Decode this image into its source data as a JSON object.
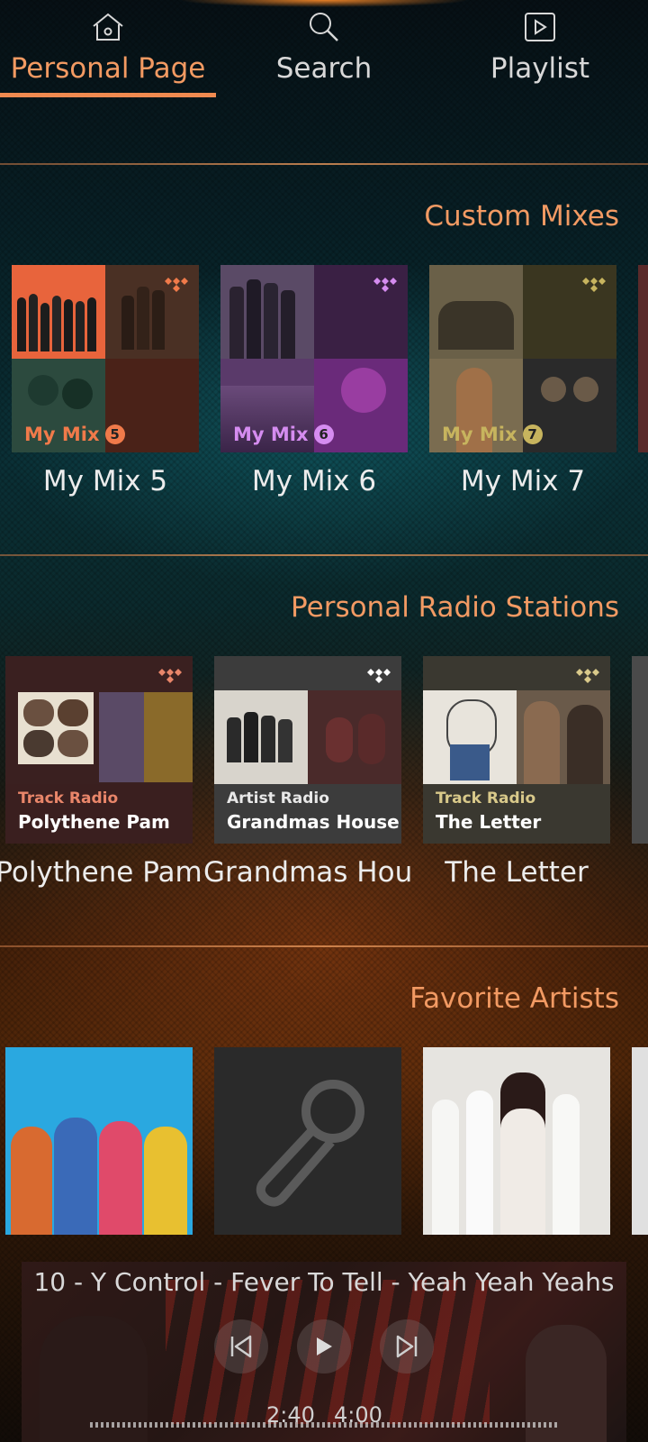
{
  "tabs": [
    {
      "label": "Personal Page",
      "icon": "home-icon",
      "active": true
    },
    {
      "label": "Search",
      "icon": "search-icon",
      "active": false
    },
    {
      "label": "Playlist",
      "icon": "playlist-icon",
      "active": false
    }
  ],
  "custom_mixes": {
    "title": "Custom Mixes",
    "items": [
      {
        "label": "My Mix 5",
        "badge_text": "My Mix",
        "badge_num": "5",
        "accent": "#f07a4a"
      },
      {
        "label": "My Mix 6",
        "badge_text": "My Mix",
        "badge_num": "6",
        "accent": "#d58cf0"
      },
      {
        "label": "My Mix 7",
        "badge_text": "My Mix",
        "badge_num": "7",
        "accent": "#c7b45e"
      }
    ]
  },
  "radio_stations": {
    "title": "Personal Radio Stations",
    "items": [
      {
        "label": "Polythene Pam",
        "type": "Track Radio",
        "name": "Polythene Pam",
        "type_color": "#e9866a"
      },
      {
        "label": "Grandmas House",
        "type": "Artist Radio",
        "name": "Grandmas House",
        "type_color": "#e8e8e8"
      },
      {
        "label": "The Letter",
        "type": "Track Radio",
        "name": "The Letter",
        "type_color": "#d9c98a"
      }
    ]
  },
  "favorite_artists": {
    "title": "Favorite Artists"
  },
  "player": {
    "now_playing": "10 - Y Control - Fever To Tell - Yeah Yeah Yeahs",
    "elapsed": "2:40",
    "total": "4:00"
  }
}
